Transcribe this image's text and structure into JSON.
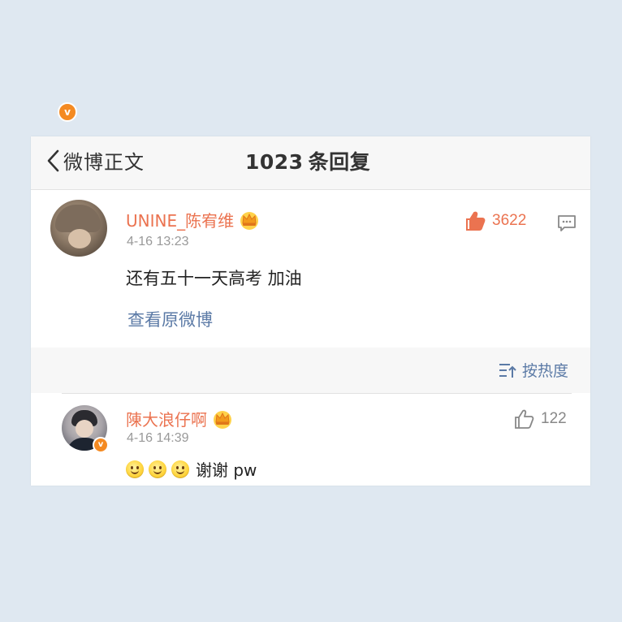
{
  "nav": {
    "back_label": "微博正文",
    "reply_count": "1023",
    "title_suffix": "条回复"
  },
  "main_comment": {
    "username": "UNINE_陈宥维",
    "time": "4-16 13:23",
    "like_count": "3622",
    "text": "还有五十一天高考 加油",
    "view_original": "查看原微博",
    "verified_badge": "v",
    "crown_icon": "crown-icon",
    "like_icon": "thumbs-up-icon",
    "reply_icon": "comment-icon"
  },
  "sort": {
    "label": "按热度",
    "icon": "sort-icon"
  },
  "replies": [
    {
      "username": "陳大浪仔啊",
      "time": "4-16 14:39",
      "like_count": "122",
      "text": "谢谢 pw",
      "emoji_count": 3,
      "verified_badge": "v"
    }
  ],
  "colors": {
    "accent_orange": "#eb7350",
    "link_blue": "#5b7aa6",
    "badge_orange": "#f48a22",
    "background": "#dfe8f1"
  }
}
